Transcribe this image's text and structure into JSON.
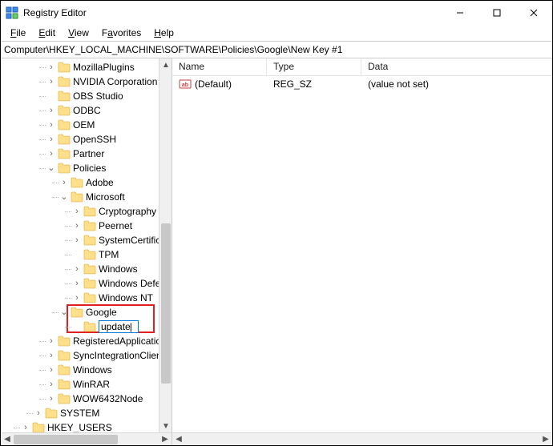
{
  "window": {
    "title": "Registry Editor"
  },
  "menu": {
    "file": "File",
    "edit": "Edit",
    "view": "View",
    "favorites": "Favorites",
    "help": "Help"
  },
  "address": "Computer\\HKEY_LOCAL_MACHINE\\SOFTWARE\\Policies\\Google\\New Key #1",
  "tree": {
    "items": [
      {
        "label": "MozillaPlugins",
        "depth": 3,
        "expander": ">"
      },
      {
        "label": "NVIDIA Corporation",
        "depth": 3,
        "expander": ">"
      },
      {
        "label": "OBS Studio",
        "depth": 3,
        "expander": ""
      },
      {
        "label": "ODBC",
        "depth": 3,
        "expander": ">"
      },
      {
        "label": "OEM",
        "depth": 3,
        "expander": ">"
      },
      {
        "label": "OpenSSH",
        "depth": 3,
        "expander": ">"
      },
      {
        "label": "Partner",
        "depth": 3,
        "expander": ">"
      },
      {
        "label": "Policies",
        "depth": 3,
        "expander": "v"
      },
      {
        "label": "Adobe",
        "depth": 4,
        "expander": ">"
      },
      {
        "label": "Microsoft",
        "depth": 4,
        "expander": "v"
      },
      {
        "label": "Cryptography",
        "depth": 5,
        "expander": ">"
      },
      {
        "label": "Peernet",
        "depth": 5,
        "expander": ">"
      },
      {
        "label": "SystemCertifica",
        "depth": 5,
        "expander": ">"
      },
      {
        "label": "TPM",
        "depth": 5,
        "expander": ""
      },
      {
        "label": "Windows",
        "depth": 5,
        "expander": ">"
      },
      {
        "label": "Windows Defen",
        "depth": 5,
        "expander": ">"
      },
      {
        "label": "Windows NT",
        "depth": 5,
        "expander": ">"
      },
      {
        "label": "Google",
        "depth": 4,
        "expander": "v",
        "highlighted": true
      },
      {
        "label": "update",
        "depth": 5,
        "expander": "",
        "editing": true
      },
      {
        "label": "RegisteredApplication",
        "depth": 3,
        "expander": ">"
      },
      {
        "label": "SyncIntegrationClient",
        "depth": 3,
        "expander": ">"
      },
      {
        "label": "Windows",
        "depth": 3,
        "expander": ">"
      },
      {
        "label": "WinRAR",
        "depth": 3,
        "expander": ">"
      },
      {
        "label": "WOW6432Node",
        "depth": 3,
        "expander": ">"
      },
      {
        "label": "SYSTEM",
        "depth": 2,
        "expander": ">"
      },
      {
        "label": "HKEY_USERS",
        "depth": 1,
        "expander": ">"
      }
    ]
  },
  "list": {
    "headers": {
      "name": "Name",
      "type": "Type",
      "data": "Data"
    },
    "rows": [
      {
        "name": "(Default)",
        "type": "REG_SZ",
        "data": "(value not set)"
      }
    ]
  }
}
